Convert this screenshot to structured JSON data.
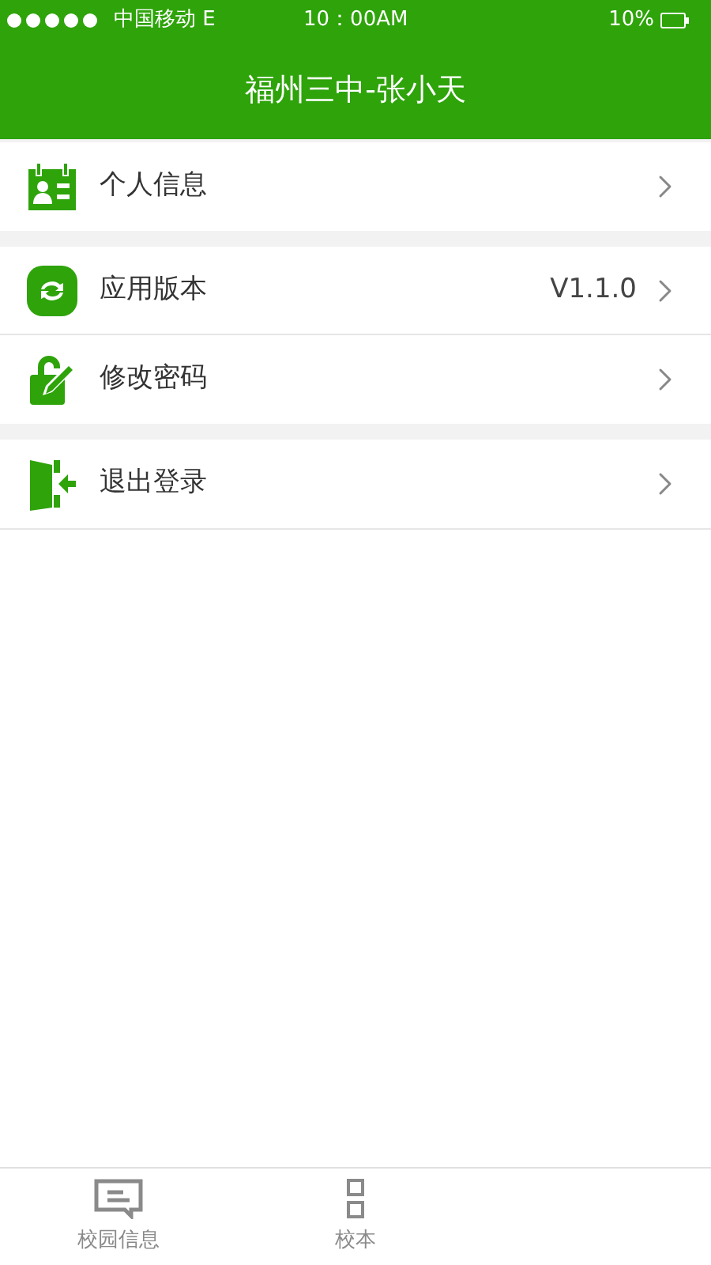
{
  "status_bar": {
    "carrier": "中国移动 E",
    "time": "10：00AM",
    "battery": "10%"
  },
  "header": {
    "title": "福州三中-张小天"
  },
  "groups": [
    [
      {
        "kind": "contact",
        "label": "个人信息"
      }
    ],
    [
      {
        "kind": "refresh",
        "label": "应用版本",
        "value": "V1.1.0"
      },
      {
        "kind": "lock",
        "label": "修改密码"
      }
    ],
    [
      {
        "kind": "exit",
        "label": "退出登录"
      }
    ]
  ],
  "tab_bar": [
    {
      "kind": "message",
      "label": "校园信息"
    },
    {
      "kind": "grid",
      "label": "校本"
    }
  ]
}
